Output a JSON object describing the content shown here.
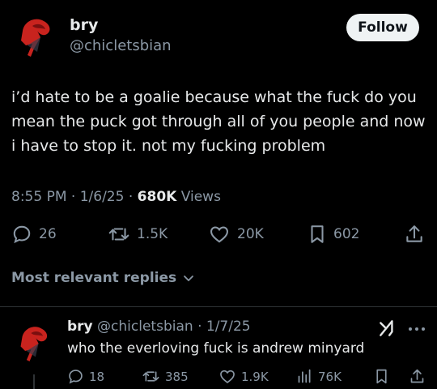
{
  "post": {
    "display_name": "bry",
    "handle": "@chicletsbian",
    "follow_label": "Follow",
    "text": "i’d hate to be a goalie because what the fuck do you mean the puck got through all of you people and now i have to stop it. not my fucking problem",
    "time": "8:55 PM",
    "date": "1/6/25",
    "views_count": "680K",
    "views_label": "Views",
    "replies": "26",
    "reposts": "1.5K",
    "likes": "20K",
    "bookmarks": "602"
  },
  "replies_sort_label": "Most relevant replies",
  "reply": {
    "display_name": "bry",
    "handle": "@chicletsbian",
    "date": "1/7/25",
    "text": "who the everloving fuck is andrew minyard",
    "replies": "18",
    "reposts": "385",
    "likes": "1.9K",
    "views": "76K"
  },
  "colors": {
    "background": "#000000",
    "text": "#e7e9ea",
    "muted": "#8b98a5",
    "follow_bg": "#eff3f4"
  }
}
